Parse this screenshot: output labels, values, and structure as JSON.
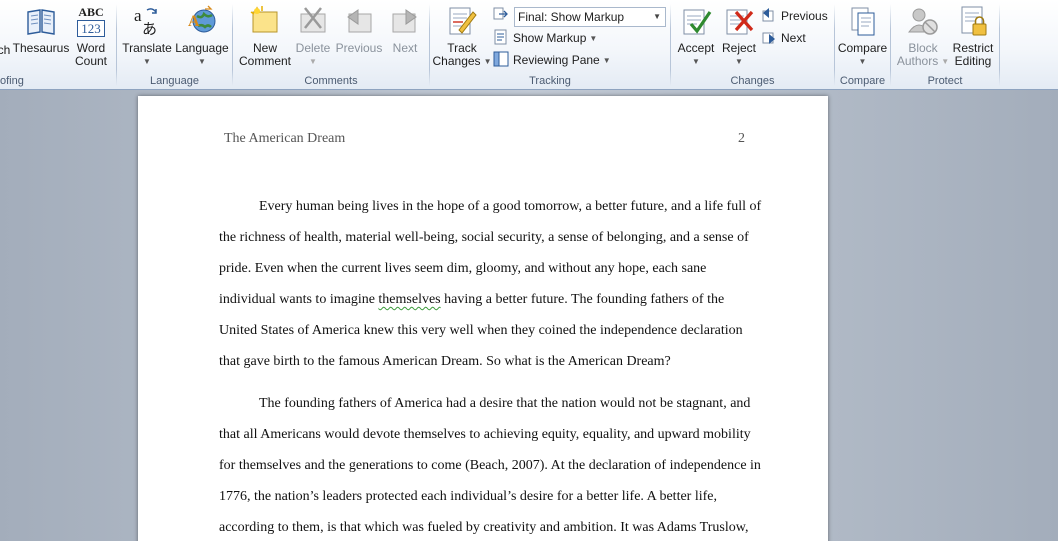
{
  "ribbon": {
    "proofing": {
      "label": "ofing",
      "spelling_label": "ch",
      "thesaurus_label": "Thesaurus",
      "wordcount_label_1": "Word",
      "wordcount_label_2": "Count",
      "abc_text": "ABC",
      "num_text": "123"
    },
    "language": {
      "label": "Language",
      "translate_label": "Translate",
      "language_label": "Language"
    },
    "comments": {
      "label": "Comments",
      "new_label_1": "New",
      "new_label_2": "Comment",
      "delete_label": "Delete",
      "previous_label": "Previous",
      "next_label": "Next"
    },
    "tracking": {
      "label": "Tracking",
      "track_label_1": "Track",
      "track_label_2": "Changes",
      "display_value": "Final: Show Markup",
      "show_markup_label": "Show Markup",
      "reviewing_pane_label": "Reviewing Pane"
    },
    "changes": {
      "label": "Changes",
      "accept_label": "Accept",
      "reject_label": "Reject",
      "previous_label": "Previous",
      "next_label": "Next"
    },
    "compare": {
      "label": "Compare",
      "compare_label": "Compare"
    },
    "protect": {
      "label": "Protect",
      "block_label_1": "Block",
      "block_label_2": "Authors",
      "restrict_label_1": "Restrict",
      "restrict_label_2": "Editing"
    }
  },
  "document": {
    "header_title": "The American Dream",
    "page_number": "2",
    "para1": [
      "Every human being lives in the hope of a good tomorrow, a better future, and a life full of",
      "the richness of health, material well-being, social security, a sense of belonging, and a sense of",
      "pride. Even when the current lives seem dim, gloomy, and without any hope, each sane",
      "individual wants to imagine ",
      "themselves",
      " having a better future. The founding fathers of the",
      "United States of America knew this very well when they coined the independence declaration",
      "that gave birth to the famous American Dream. So what is the American Dream?"
    ],
    "para2": [
      "The founding fathers of America had a desire that the nation would not be stagnant, and",
      "that all Americans would devote themselves to achieving equity, equality, and upward mobility",
      "for themselves and the generations to come (Beach, 2007). At the declaration of independence in",
      "1776, the nation’s leaders protected each individual’s desire for a better life. A better life,",
      "according to them, is that which was fueled by creativity and ambition. It was Adams Truslow,"
    ]
  },
  "colors": {
    "accent": "#2b579a",
    "ribbon_border": "#8ea3bf",
    "spell_squiggle": "#3a9a3a"
  }
}
